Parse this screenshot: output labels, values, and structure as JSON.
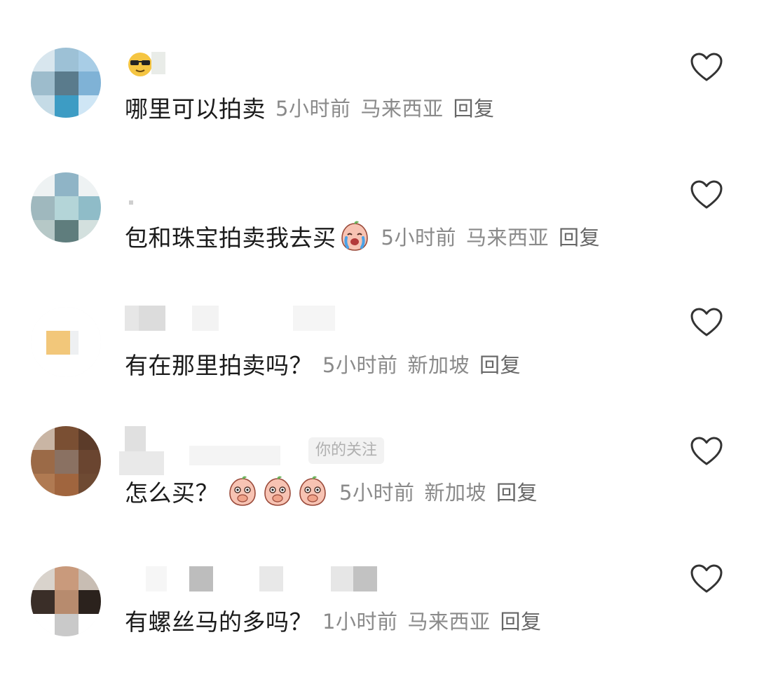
{
  "comments": [
    {
      "text": "哪里可以拍卖",
      "time": "5小时前",
      "location": "马来西亚",
      "reply_label": "回复",
      "emojis": []
    },
    {
      "text": "包和珠宝拍卖我去买",
      "time": "5小时前",
      "location": "马来西亚",
      "reply_label": "回复",
      "emojis": [
        "crying-peach-emoji"
      ]
    },
    {
      "text": "有在那里拍卖吗？",
      "time": "5小时前",
      "location": "新加坡",
      "reply_label": "回复",
      "emojis": []
    },
    {
      "text": "怎么买？",
      "time": "5小时前",
      "location": "新加坡",
      "reply_label": "回复",
      "emojis": [
        "thinking-peach-emoji",
        "thinking-peach-emoji",
        "thinking-peach-emoji"
      ],
      "username_tag": "你的关注"
    },
    {
      "text": "有螺丝马的多吗？",
      "time": "1小时前",
      "location": "马来西亚",
      "reply_label": "回复",
      "emojis": []
    }
  ],
  "icons": {
    "like": "heart-outline-icon",
    "first_user_badge": "sunglasses-face-icon"
  },
  "colors": {
    "text": "#1b1b1b",
    "meta": "#8a8a8a",
    "heart_stroke": "#333333"
  }
}
